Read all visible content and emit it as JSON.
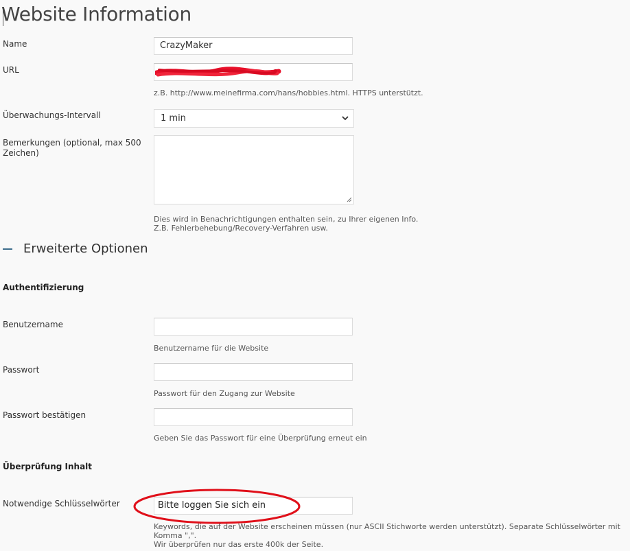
{
  "page": {
    "title": "Website Information"
  },
  "fields": {
    "name": {
      "label": "Name",
      "value": "CrazyMaker"
    },
    "url": {
      "label": "URL",
      "value": "",
      "hint": "z.B. http://www.meinefirma.com/hans/hobbies.html. HTTPS unterstützt."
    },
    "interval": {
      "label": "Überwachungs-Intervall",
      "selected": "1 min"
    },
    "remarks": {
      "label_line1": "Bemerkungen (optional, max 500",
      "label_line2": "Zeichen)",
      "hint_line1": "Dies wird in Benachrichtigungen enthalten sein, zu Ihrer eigenen Info.",
      "hint_line2": "Z.B. Fehlerbehebung/Recovery-Verfahren usw."
    }
  },
  "advanced": {
    "label": "Erweiterte Optionen"
  },
  "auth": {
    "heading": "Authentifizierung",
    "username": {
      "label": "Benutzername",
      "hint": "Benutzername für die Website"
    },
    "password": {
      "label": "Passwort",
      "hint": "Passwort für den Zugang zur Website"
    },
    "confirm": {
      "label": "Passwort bestätigen",
      "hint": "Geben Sie das Passwort für eine Überprüfung erneut ein"
    }
  },
  "content_check": {
    "heading": "Überprüfung Inhalt",
    "keywords": {
      "label": "Notwendige Schlüsselwörter",
      "value": "Bitte loggen Sie sich ein",
      "hint_line1": "Keywords, die auf der Website erscheinen müssen (nur ASCII Stichworte werden unterstützt). Separate Schlüsselwörter mit",
      "hint_line2": "Komma \",\".",
      "hint_line3": "Wir überprüfen nur das erste 400k der Seite."
    }
  },
  "colors": {
    "annotation": "#e0101a",
    "accent": "#3d6d8c"
  },
  "icons": [
    "chevron-down-icon",
    "minus-icon",
    "resize-grip-icon"
  ]
}
